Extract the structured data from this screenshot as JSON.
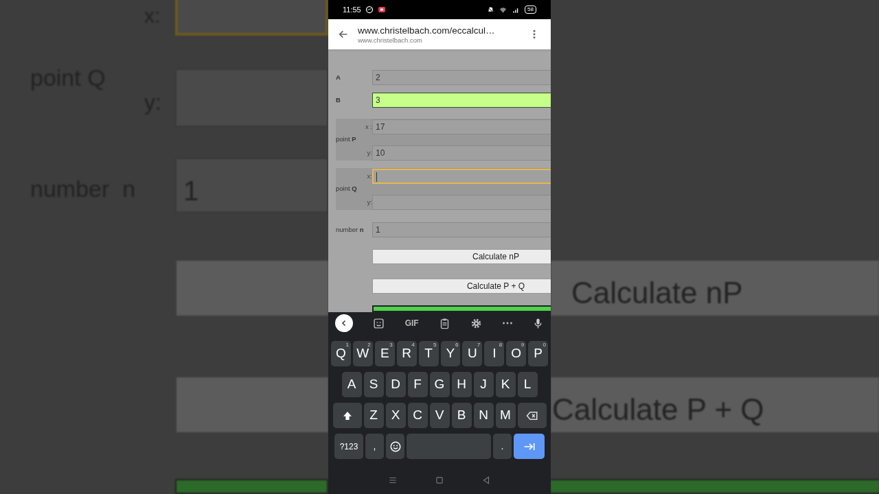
{
  "backdrop": {
    "x_label": "x:",
    "point_label": "point Q",
    "y_label": "y:",
    "number_label": "number  n",
    "number_value": "1",
    "buttons": [
      "Calculate nP",
      "Calculate P + Q"
    ]
  },
  "status_bar": {
    "time": "11:55",
    "battery": "58"
  },
  "browser": {
    "url": "www.christelbach.com/eccalcul…",
    "domain": "www.christelbach.com"
  },
  "form": {
    "rows": [
      {
        "kind": "field",
        "label": "A",
        "value": "2",
        "valid": false
      },
      {
        "kind": "field",
        "label": "B",
        "value": "3",
        "valid": true
      },
      {
        "kind": "point",
        "label": "point **P**",
        "coords": [
          {
            "axis": "x :",
            "value": "17",
            "focused": false
          },
          {
            "axis": "y:",
            "value": "10",
            "focused": false
          }
        ]
      },
      {
        "kind": "point",
        "label": "point **Q**",
        "coords": [
          {
            "axis": "x:",
            "focused": true
          },
          {
            "axis": "y:",
            "focused": false
          }
        ]
      },
      {
        "kind": "field",
        "label": "number **n**",
        "value": "1",
        "valid": false
      }
    ],
    "buttons": [
      "Calculate nP",
      "Calculate P + Q"
    ]
  },
  "keyboard": {
    "toolbar_text": "GIF",
    "rows": [
      [
        {
          "kind": "letter",
          "label": "Q",
          "hint": "1"
        },
        {
          "kind": "letter",
          "label": "W",
          "hint": "2"
        },
        {
          "kind": "letter",
          "label": "E",
          "hint": "3"
        },
        {
          "kind": "letter",
          "label": "R",
          "hint": "4"
        },
        {
          "kind": "letter",
          "label": "T",
          "hint": "5"
        },
        {
          "kind": "letter",
          "label": "Y",
          "hint": "6"
        },
        {
          "kind": "letter",
          "label": "U",
          "hint": "7"
        },
        {
          "kind": "letter",
          "label": "I",
          "hint": "8"
        },
        {
          "kind": "letter",
          "label": "O",
          "hint": "9"
        },
        {
          "kind": "letter",
          "label": "P",
          "hint": "0"
        }
      ],
      [
        {
          "kind": "letter",
          "label": "A"
        },
        {
          "kind": "letter",
          "label": "S"
        },
        {
          "kind": "letter",
          "label": "D"
        },
        {
          "kind": "letter",
          "label": "F"
        },
        {
          "kind": "letter",
          "label": "G"
        },
        {
          "kind": "letter",
          "label": "H"
        },
        {
          "kind": "letter",
          "label": "J"
        },
        {
          "kind": "letter",
          "label": "K"
        },
        {
          "kind": "letter",
          "label": "L"
        }
      ],
      [
        {
          "kind": "shift"
        },
        {
          "kind": "letter",
          "label": "Z"
        },
        {
          "kind": "letter",
          "label": "X"
        },
        {
          "kind": "letter",
          "label": "C"
        },
        {
          "kind": "letter",
          "label": "V"
        },
        {
          "kind": "letter",
          "label": "B"
        },
        {
          "kind": "letter",
          "label": "N"
        },
        {
          "kind": "letter",
          "label": "M"
        },
        {
          "kind": "backspace"
        }
      ],
      [
        {
          "kind": "symbols",
          "label": "?123"
        },
        {
          "kind": "punct",
          "label": ","
        },
        {
          "kind": "emoji"
        },
        {
          "kind": "space"
        },
        {
          "kind": "punct",
          "label": "."
        },
        {
          "kind": "enter"
        }
      ]
    ]
  }
}
